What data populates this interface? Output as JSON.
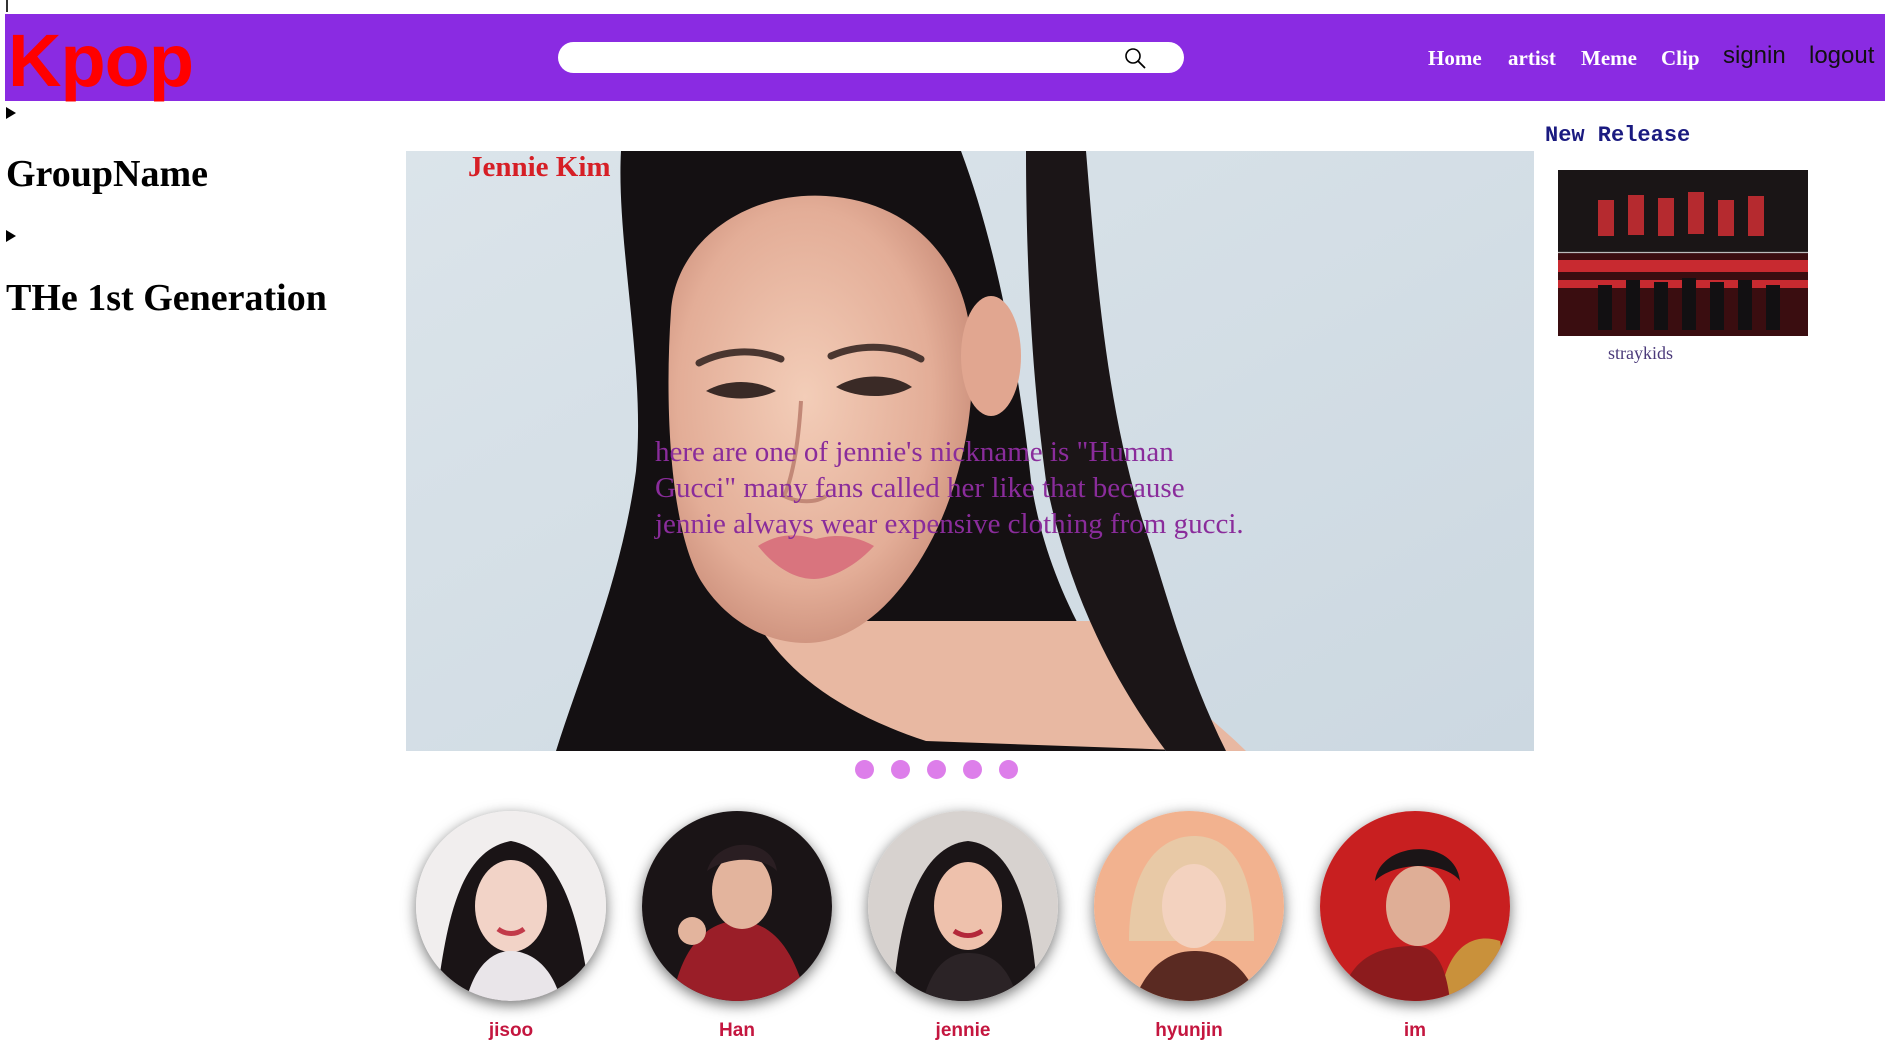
{
  "header": {
    "logo": "Kpop",
    "search": {
      "placeholder": "",
      "value": ""
    },
    "nav": [
      "Home",
      "artist",
      "Meme",
      "Clip"
    ],
    "auth": {
      "signin": "signin",
      "logout": "logout"
    }
  },
  "sidebar": {
    "headings": [
      "GroupName",
      "THe 1st Generation"
    ]
  },
  "hero": {
    "name": "Jennie Kim",
    "caption": "here are one of jennie's nickname is \"Human Gucci\" many fans called her like that because jennie always wear expensive clothing from gucci.",
    "slide_count": 5
  },
  "members": [
    "jisoo",
    "Han",
    "jennie",
    "hyunjin",
    "im"
  ],
  "new_release": {
    "title": "New Release",
    "caption": "straykids"
  },
  "colors": {
    "header_bg": "#8a2be2",
    "logo": "#ff0000",
    "hero_name": "#d61f26",
    "hero_caption": "#8a2c9b",
    "dot": "#dd7eea",
    "member_name": "#c4163f",
    "new_release_title": "#1a1a80"
  },
  "icons": {
    "search": "search-icon",
    "slide_dot": "slide-dot"
  }
}
